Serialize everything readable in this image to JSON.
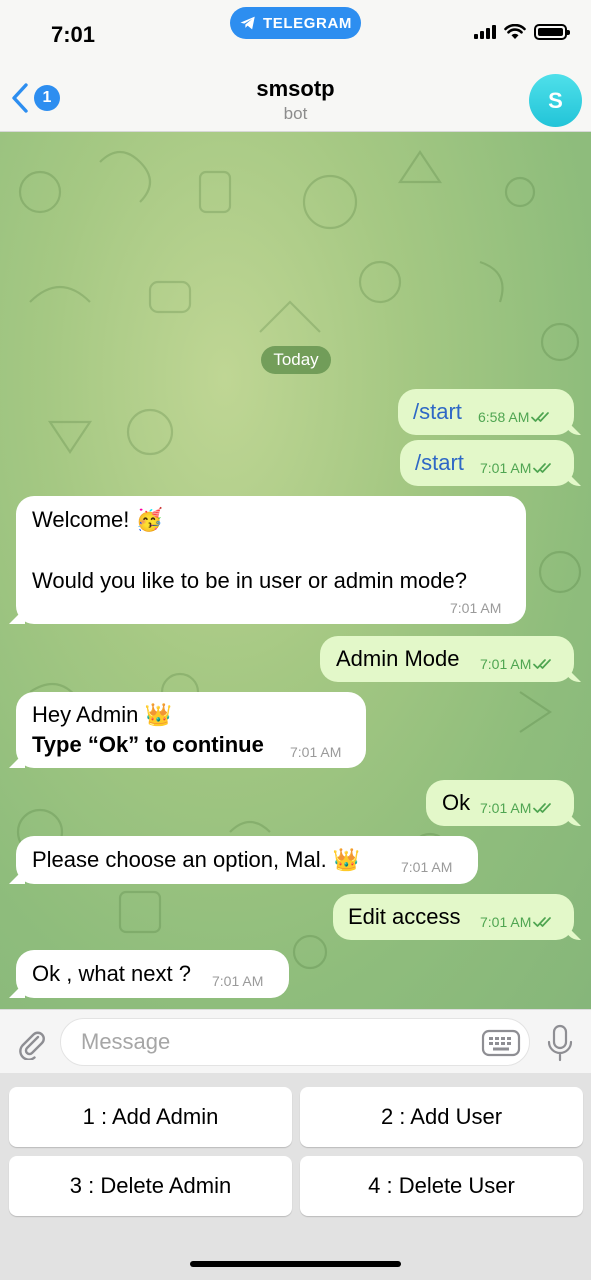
{
  "status_bar": {
    "time": "7:01",
    "return_pill": "TELEGRAM"
  },
  "header": {
    "back_badge": "1",
    "title": "smsotp",
    "subtitle": "bot",
    "avatar_letter": "S",
    "avatar_color": "#2cc9dc"
  },
  "chat": {
    "date_chip": "Today",
    "messages": [
      {
        "side": "out",
        "text": "/start",
        "time": "6:58 AM",
        "status": "read"
      },
      {
        "side": "out",
        "text": "/start",
        "time": "7:01 AM",
        "status": "read"
      },
      {
        "side": "in",
        "line1": "Welcome! 🥳",
        "line2": "Would you like to be in user or admin mode?",
        "time": "7:01 AM"
      },
      {
        "side": "out",
        "text": "Admin Mode",
        "time": "7:01 AM",
        "status": "read"
      },
      {
        "side": "in",
        "line1": "Hey Admin 👑",
        "line2": "Type “Ok” to continue",
        "time": "7:01 AM"
      },
      {
        "side": "out",
        "text": "Ok",
        "time": "7:01 AM",
        "status": "read"
      },
      {
        "side": "in",
        "text": "Please choose an option, Mal. 👑",
        "time": "7:01 AM"
      },
      {
        "side": "out",
        "text": "Edit access",
        "time": "7:01 AM",
        "status": "read"
      },
      {
        "side": "in",
        "text": "Ok , what next ?",
        "time": "7:01 AM"
      }
    ]
  },
  "input": {
    "placeholder": "Message",
    "value": ""
  },
  "keyboard": {
    "buttons": [
      "1 : Add Admin",
      "2 : Add User",
      "3 : Delete Admin",
      "4 : Delete User"
    ]
  },
  "colors": {
    "accent": "#2d8ef0",
    "outgoing_bubble": "#e3f8c9",
    "incoming_bubble": "#ffffff",
    "read_check": "#4fa551",
    "command_link": "#2e68c6"
  }
}
